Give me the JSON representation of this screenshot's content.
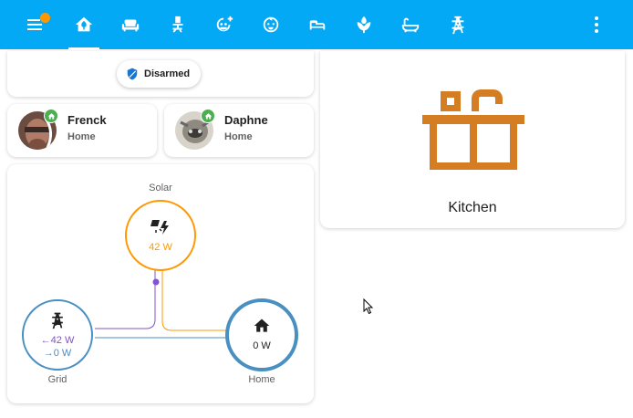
{
  "topbar": {
    "background": "#03a9f4",
    "notification_color": "#ff9800",
    "tabs": [
      {
        "icon": "home-icon",
        "active": true
      },
      {
        "icon": "sofa-icon"
      },
      {
        "icon": "desk-chair-icon"
      },
      {
        "icon": "emoticon-plus-icon"
      },
      {
        "icon": "baby-face-icon"
      },
      {
        "icon": "bed-icon"
      },
      {
        "icon": "flower-icon"
      },
      {
        "icon": "bathtub-icon"
      },
      {
        "icon": "transmission-tower-icon"
      }
    ]
  },
  "alarm": {
    "state": "Disarmed",
    "icon": "shield-check-icon"
  },
  "persons": [
    {
      "name": "Frenck",
      "state": "Home",
      "badge_icon": "home-icon"
    },
    {
      "name": "Daphne",
      "state": "Home",
      "badge_icon": "home-icon"
    }
  ],
  "energy": {
    "solar": {
      "label": "Solar",
      "value": "42 W",
      "color": "#ff9800"
    },
    "grid": {
      "label": "Grid",
      "consumption": "42 W",
      "return": "0 W",
      "color": "#488fc2"
    },
    "home": {
      "label": "Home",
      "value": "0 W"
    },
    "battery_color": "#8353d1"
  },
  "area": {
    "name": "Kitchen",
    "icon": "countertop-icon",
    "icon_color": "#d57d23"
  }
}
